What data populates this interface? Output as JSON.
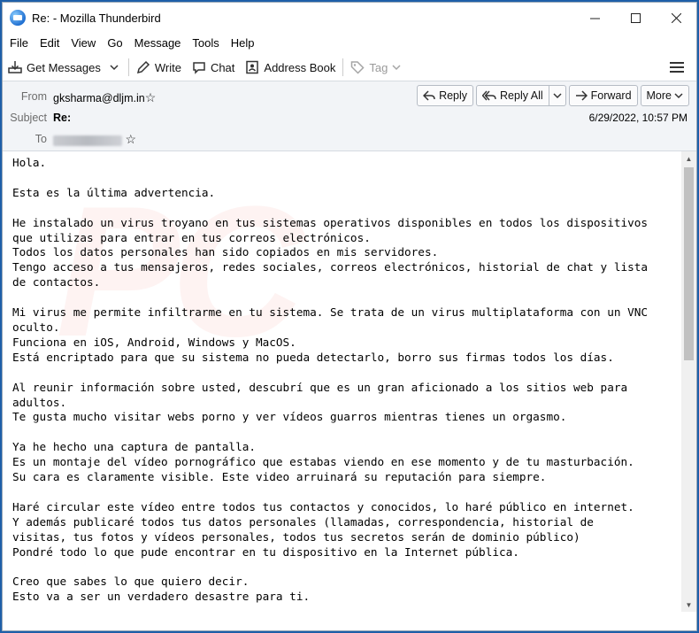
{
  "window": {
    "title": "Re: - Mozilla Thunderbird"
  },
  "menu": [
    "File",
    "Edit",
    "View",
    "Go",
    "Message",
    "Tools",
    "Help"
  ],
  "toolbar": {
    "get_messages": "Get Messages",
    "write": "Write",
    "chat": "Chat",
    "address_book": "Address Book",
    "tag": "Tag"
  },
  "header": {
    "from_label": "From",
    "from_value": "gksharma@dljm.in",
    "subject_label": "Subject",
    "subject_value": "Re:",
    "to_label": "To",
    "date": "6/29/2022, 10:57 PM",
    "reply": "Reply",
    "reply_all": "Reply All",
    "forward": "Forward",
    "more": "More"
  },
  "body": {
    "text": "Hola.\n\nEsta es la última advertencia.\n\nHe instalado un virus troyano en tus sistemas operativos disponibles en todos los dispositivos\nque utilizas para entrar en tus correos electrónicos.\nTodos los datos personales han sido copiados en mis servidores.\nTengo acceso a tus mensajeros, redes sociales, correos electrónicos, historial de chat y lista\nde contactos.\n\nMi virus me permite infiltrarme en tu sistema. Se trata de un virus multiplataforma con un VNC\noculto.\nFunciona en iOS, Android, Windows y MacOS.\nEstá encriptado para que su sistema no pueda detectarlo, borro sus firmas todos los días.\n\nAl reunir información sobre usted, descubrí que es un gran aficionado a los sitios web para\nadultos.\nTe gusta mucho visitar webs porno y ver vídeos guarros mientras tienes un orgasmo.\n\nYa he hecho una captura de pantalla.\nEs un montaje del vídeo pornográfico que estabas viendo en ese momento y de tu masturbación.\nSu cara es claramente visible. Este video arruinará su reputación para siempre.\n\nHaré circular este vídeo entre todos tus contactos y conocidos, lo haré público en internet.\nY además publicaré todos tus datos personales (llamadas, correspondencia, historial de\nvisitas, tus fotos y vídeos personales, todos tus secretos serán de dominio público)\nPondré todo lo que pude encontrar en tu dispositivo en la Internet pública.\n\nCreo que sabes lo que quiero decir.\nEsto va a ser un verdadero desastre para ti."
  }
}
